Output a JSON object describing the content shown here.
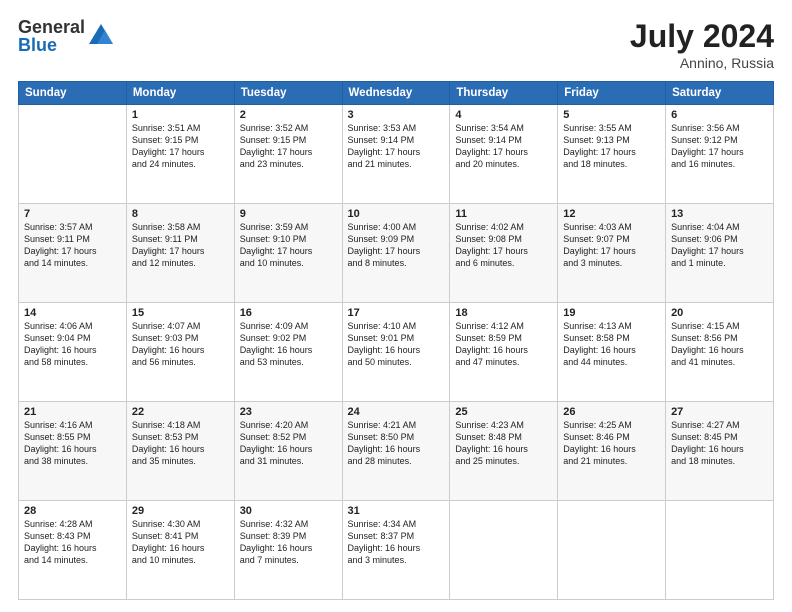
{
  "logo": {
    "general": "General",
    "blue": "Blue"
  },
  "title": {
    "month_year": "July 2024",
    "location": "Annino, Russia"
  },
  "header_days": [
    "Sunday",
    "Monday",
    "Tuesday",
    "Wednesday",
    "Thursday",
    "Friday",
    "Saturday"
  ],
  "weeks": [
    [
      {
        "day": "",
        "info": ""
      },
      {
        "day": "1",
        "info": "Sunrise: 3:51 AM\nSunset: 9:15 PM\nDaylight: 17 hours\nand 24 minutes."
      },
      {
        "day": "2",
        "info": "Sunrise: 3:52 AM\nSunset: 9:15 PM\nDaylight: 17 hours\nand 23 minutes."
      },
      {
        "day": "3",
        "info": "Sunrise: 3:53 AM\nSunset: 9:14 PM\nDaylight: 17 hours\nand 21 minutes."
      },
      {
        "day": "4",
        "info": "Sunrise: 3:54 AM\nSunset: 9:14 PM\nDaylight: 17 hours\nand 20 minutes."
      },
      {
        "day": "5",
        "info": "Sunrise: 3:55 AM\nSunset: 9:13 PM\nDaylight: 17 hours\nand 18 minutes."
      },
      {
        "day": "6",
        "info": "Sunrise: 3:56 AM\nSunset: 9:12 PM\nDaylight: 17 hours\nand 16 minutes."
      }
    ],
    [
      {
        "day": "7",
        "info": "Sunrise: 3:57 AM\nSunset: 9:11 PM\nDaylight: 17 hours\nand 14 minutes."
      },
      {
        "day": "8",
        "info": "Sunrise: 3:58 AM\nSunset: 9:11 PM\nDaylight: 17 hours\nand 12 minutes."
      },
      {
        "day": "9",
        "info": "Sunrise: 3:59 AM\nSunset: 9:10 PM\nDaylight: 17 hours\nand 10 minutes."
      },
      {
        "day": "10",
        "info": "Sunrise: 4:00 AM\nSunset: 9:09 PM\nDaylight: 17 hours\nand 8 minutes."
      },
      {
        "day": "11",
        "info": "Sunrise: 4:02 AM\nSunset: 9:08 PM\nDaylight: 17 hours\nand 6 minutes."
      },
      {
        "day": "12",
        "info": "Sunrise: 4:03 AM\nSunset: 9:07 PM\nDaylight: 17 hours\nand 3 minutes."
      },
      {
        "day": "13",
        "info": "Sunrise: 4:04 AM\nSunset: 9:06 PM\nDaylight: 17 hours\nand 1 minute."
      }
    ],
    [
      {
        "day": "14",
        "info": "Sunrise: 4:06 AM\nSunset: 9:04 PM\nDaylight: 16 hours\nand 58 minutes."
      },
      {
        "day": "15",
        "info": "Sunrise: 4:07 AM\nSunset: 9:03 PM\nDaylight: 16 hours\nand 56 minutes."
      },
      {
        "day": "16",
        "info": "Sunrise: 4:09 AM\nSunset: 9:02 PM\nDaylight: 16 hours\nand 53 minutes."
      },
      {
        "day": "17",
        "info": "Sunrise: 4:10 AM\nSunset: 9:01 PM\nDaylight: 16 hours\nand 50 minutes."
      },
      {
        "day": "18",
        "info": "Sunrise: 4:12 AM\nSunset: 8:59 PM\nDaylight: 16 hours\nand 47 minutes."
      },
      {
        "day": "19",
        "info": "Sunrise: 4:13 AM\nSunset: 8:58 PM\nDaylight: 16 hours\nand 44 minutes."
      },
      {
        "day": "20",
        "info": "Sunrise: 4:15 AM\nSunset: 8:56 PM\nDaylight: 16 hours\nand 41 minutes."
      }
    ],
    [
      {
        "day": "21",
        "info": "Sunrise: 4:16 AM\nSunset: 8:55 PM\nDaylight: 16 hours\nand 38 minutes."
      },
      {
        "day": "22",
        "info": "Sunrise: 4:18 AM\nSunset: 8:53 PM\nDaylight: 16 hours\nand 35 minutes."
      },
      {
        "day": "23",
        "info": "Sunrise: 4:20 AM\nSunset: 8:52 PM\nDaylight: 16 hours\nand 31 minutes."
      },
      {
        "day": "24",
        "info": "Sunrise: 4:21 AM\nSunset: 8:50 PM\nDaylight: 16 hours\nand 28 minutes."
      },
      {
        "day": "25",
        "info": "Sunrise: 4:23 AM\nSunset: 8:48 PM\nDaylight: 16 hours\nand 25 minutes."
      },
      {
        "day": "26",
        "info": "Sunrise: 4:25 AM\nSunset: 8:46 PM\nDaylight: 16 hours\nand 21 minutes."
      },
      {
        "day": "27",
        "info": "Sunrise: 4:27 AM\nSunset: 8:45 PM\nDaylight: 16 hours\nand 18 minutes."
      }
    ],
    [
      {
        "day": "28",
        "info": "Sunrise: 4:28 AM\nSunset: 8:43 PM\nDaylight: 16 hours\nand 14 minutes."
      },
      {
        "day": "29",
        "info": "Sunrise: 4:30 AM\nSunset: 8:41 PM\nDaylight: 16 hours\nand 10 minutes."
      },
      {
        "day": "30",
        "info": "Sunrise: 4:32 AM\nSunset: 8:39 PM\nDaylight: 16 hours\nand 7 minutes."
      },
      {
        "day": "31",
        "info": "Sunrise: 4:34 AM\nSunset: 8:37 PM\nDaylight: 16 hours\nand 3 minutes."
      },
      {
        "day": "",
        "info": ""
      },
      {
        "day": "",
        "info": ""
      },
      {
        "day": "",
        "info": ""
      }
    ]
  ]
}
